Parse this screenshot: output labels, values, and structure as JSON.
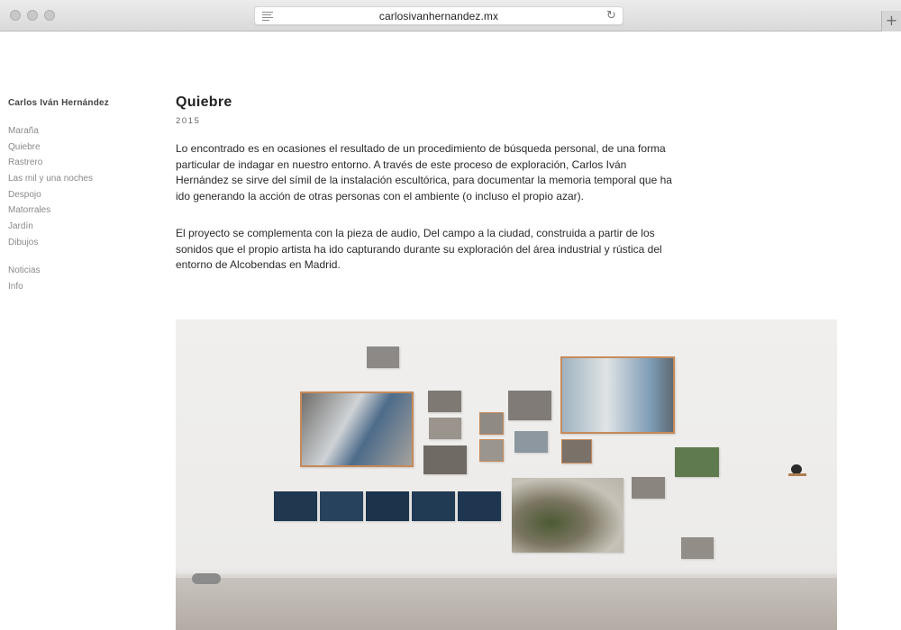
{
  "browser": {
    "url": "carlosivanhernandez.mx",
    "new_tab_glyph": "+",
    "reload_glyph": "↻"
  },
  "site": {
    "name": "Carlos Iván Hernández"
  },
  "nav": {
    "projects": [
      "Maraña",
      "Quiebre",
      "Rastrero",
      "Las mil y una noches",
      "Despojo",
      "Matorrales",
      "Jardín",
      "Dibujos"
    ],
    "secondary": [
      "Noticias",
      "Info"
    ]
  },
  "article": {
    "title": "Quiebre",
    "year": "2015",
    "paragraph1": "Lo encontrado es en ocasiones el resultado de un procedimiento de búsqueda personal, de una forma particular de indagar en nuestro entorno. A través de este proceso de exploración, Carlos Iván Hernández se sirve del símil de la instalación escultórica, para documentar la memoria temporal que ha ido generando la acción de otras personas con el ambiente (o incluso el propio azar).",
    "paragraph2": "El proyecto se complementa con la pieza de audio, Del campo a la ciudad, construida a partir de los sonidos que el propio artista ha ido capturando durante su exploración del área industrial y rústica del entorno de Alcobendas en Madrid."
  },
  "colors": {
    "frame": "#c68a5a",
    "text": "#2a2a2a",
    "nav": "#8a8a8a"
  }
}
